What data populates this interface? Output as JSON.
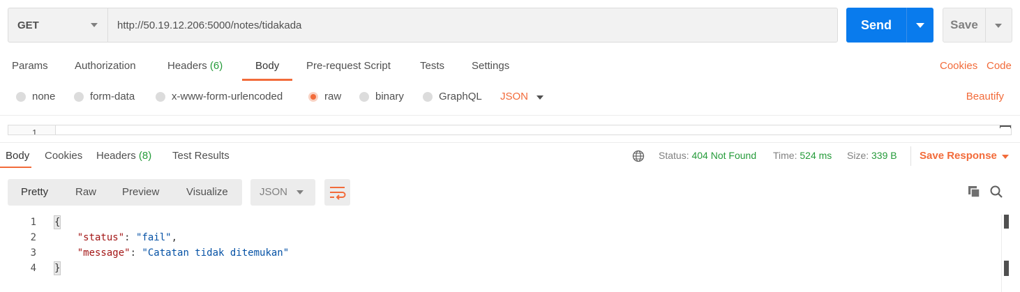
{
  "request": {
    "method": "GET",
    "url": "http://50.19.12.206:5000/notes/tidakada",
    "send_label": "Send",
    "save_label": "Save"
  },
  "request_tabs": {
    "params": "Params",
    "authorization": "Authorization",
    "headers": "Headers",
    "headers_count": "(6)",
    "body": "Body",
    "pre_request": "Pre-request Script",
    "tests": "Tests",
    "settings": "Settings",
    "cookies": "Cookies",
    "code": "Code"
  },
  "body_types": {
    "none": "none",
    "form_data": "form-data",
    "urlencoded": "x-www-form-urlencoded",
    "raw": "raw",
    "binary": "binary",
    "graphql": "GraphQL",
    "selected": "raw",
    "content_type": "JSON",
    "beautify": "Beautify"
  },
  "request_editor": {
    "line_number": "1"
  },
  "response_tabs": {
    "body": "Body",
    "cookies": "Cookies",
    "headers": "Headers",
    "headers_count": "(8)",
    "test_results": "Test Results"
  },
  "response_status": {
    "status_label": "Status:",
    "status_value": "404 Not Found",
    "time_label": "Time:",
    "time_value": "524 ms",
    "size_label": "Size:",
    "size_value": "339 B",
    "save_response": "Save Response"
  },
  "view_options": {
    "pretty": "Pretty",
    "raw": "Raw",
    "preview": "Preview",
    "visualize": "Visualize",
    "format": "JSON"
  },
  "response_body": {
    "lines": [
      {
        "num": "1",
        "open_brace": "{"
      },
      {
        "num": "2",
        "key": "\"status\"",
        "value": "\"fail\"",
        "trail": ","
      },
      {
        "num": "3",
        "key": "\"message\"",
        "value": "\"Catatan tidak ditemukan\"",
        "trail": ""
      },
      {
        "num": "4",
        "close_brace": "}"
      }
    ]
  },
  "colors": {
    "accent": "#f26b3a",
    "send_blue": "#097bed",
    "success_green": "#259b3a"
  },
  "icons": {
    "method_dropdown": "chevron-down-icon",
    "globe": "globe-icon",
    "wrap": "wrap-lines-icon",
    "copy": "copy-icon",
    "search": "search-icon"
  }
}
